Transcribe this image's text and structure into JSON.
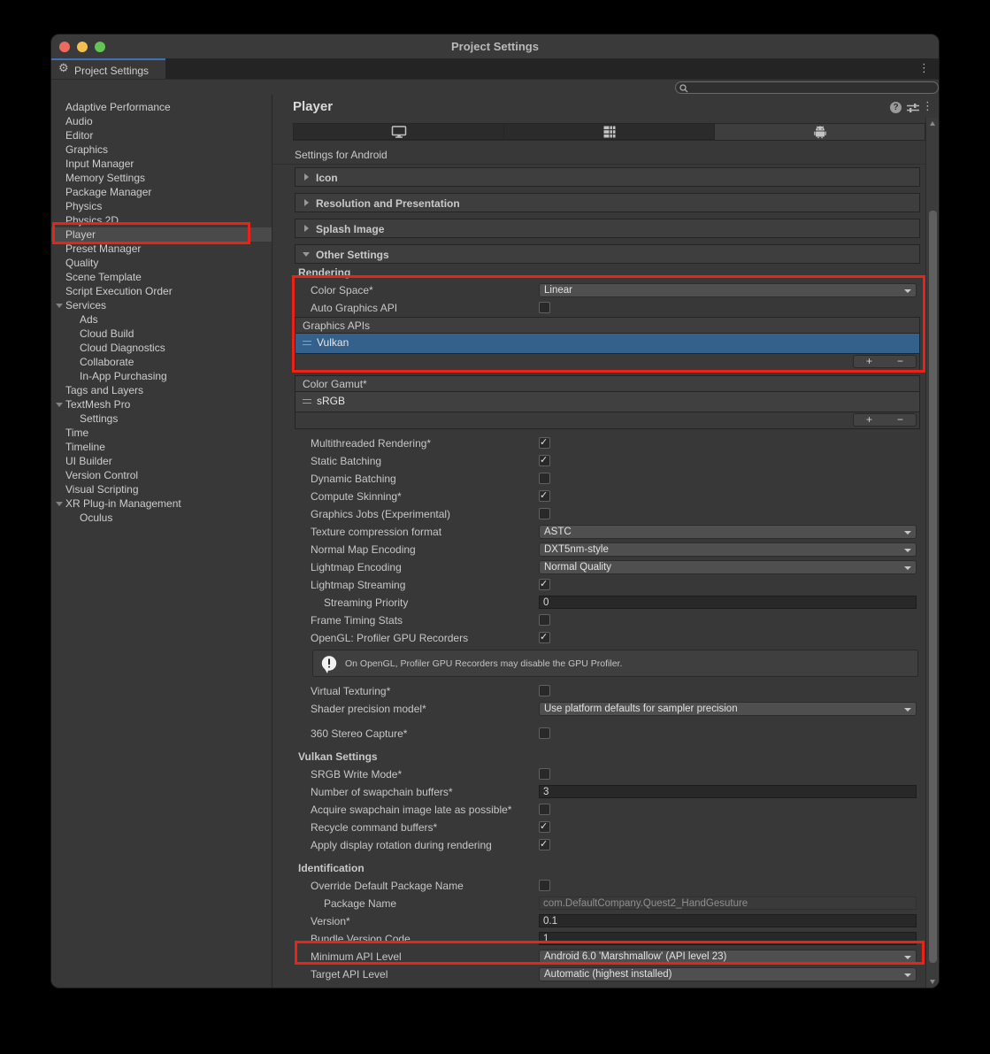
{
  "window": {
    "title": "Project Settings",
    "tab_label": "Project Settings"
  },
  "search": {
    "value": "",
    "placeholder": ""
  },
  "sidebar": {
    "items": [
      {
        "label": "Adaptive Performance",
        "level": 1
      },
      {
        "label": "Audio",
        "level": 1
      },
      {
        "label": "Editor",
        "level": 1
      },
      {
        "label": "Graphics",
        "level": 1
      },
      {
        "label": "Input Manager",
        "level": 1
      },
      {
        "label": "Memory Settings",
        "level": 1
      },
      {
        "label": "Package Manager",
        "level": 1
      },
      {
        "label": "Physics",
        "level": 1
      },
      {
        "label": "Physics 2D",
        "level": 1
      },
      {
        "label": "Player",
        "level": 1,
        "selected": true
      },
      {
        "label": "Preset Manager",
        "level": 1
      },
      {
        "label": "Quality",
        "level": 1
      },
      {
        "label": "Scene Template",
        "level": 1
      },
      {
        "label": "Script Execution Order",
        "level": 1
      },
      {
        "label": "Services",
        "level": 1,
        "expander": true
      },
      {
        "label": "Ads",
        "level": 2
      },
      {
        "label": "Cloud Build",
        "level": 2
      },
      {
        "label": "Cloud Diagnostics",
        "level": 2
      },
      {
        "label": "Collaborate",
        "level": 2
      },
      {
        "label": "In-App Purchasing",
        "level": 2
      },
      {
        "label": "Tags and Layers",
        "level": 1
      },
      {
        "label": "TextMesh Pro",
        "level": 1,
        "expander": true
      },
      {
        "label": "Settings",
        "level": 2
      },
      {
        "label": "Time",
        "level": 1
      },
      {
        "label": "Timeline",
        "level": 1
      },
      {
        "label": "UI Builder",
        "level": 1
      },
      {
        "label": "Version Control",
        "level": 1
      },
      {
        "label": "Visual Scripting",
        "level": 1
      },
      {
        "label": "XR Plug-in Management",
        "level": 1,
        "expander": true
      },
      {
        "label": "Oculus",
        "level": 2
      }
    ]
  },
  "player": {
    "title": "Player",
    "context": "Settings for Android"
  },
  "platform_tabs": [
    {
      "icon": "desktop-icon",
      "selected": false
    },
    {
      "icon": "dedicated-server-icon",
      "selected": false
    },
    {
      "icon": "android-icon",
      "selected": true
    }
  ],
  "foldouts": [
    {
      "label": "Icon",
      "expanded": false
    },
    {
      "label": "Resolution and Presentation",
      "expanded": false
    },
    {
      "label": "Splash Image",
      "expanded": false
    },
    {
      "label": "Other Settings",
      "expanded": true
    }
  ],
  "rows": [
    {
      "t": "section",
      "label": "Rendering"
    },
    {
      "t": "dropdown",
      "label": "Color Space*",
      "value": "Linear"
    },
    {
      "t": "check",
      "label": "Auto Graphics API",
      "checked": false
    },
    {
      "t": "list",
      "header": "Graphics APIs",
      "items": [
        {
          "label": "Vulkan",
          "selected": true
        }
      ],
      "add_label": "+",
      "remove_label": "−"
    },
    {
      "t": "gap",
      "h": 5
    },
    {
      "t": "list",
      "header": "Color Gamut*",
      "items": [
        {
          "label": "sRGB",
          "selected": false
        }
      ],
      "add_label": "+",
      "remove_label": "−"
    },
    {
      "t": "gap",
      "h": 6
    },
    {
      "t": "check",
      "label": "Multithreaded Rendering*",
      "checked": true
    },
    {
      "t": "check",
      "label": "Static Batching",
      "checked": true
    },
    {
      "t": "check",
      "label": "Dynamic Batching",
      "checked": false
    },
    {
      "t": "check",
      "label": "Compute Skinning*",
      "checked": true
    },
    {
      "t": "check",
      "label": "Graphics Jobs (Experimental)",
      "checked": false
    },
    {
      "t": "dropdown",
      "label": "Texture compression format",
      "value": "ASTC"
    },
    {
      "t": "dropdown",
      "label": "Normal Map Encoding",
      "value": "DXT5nm-style"
    },
    {
      "t": "dropdown",
      "label": "Lightmap Encoding",
      "value": "Normal Quality"
    },
    {
      "t": "check",
      "label": "Lightmap Streaming",
      "checked": true
    },
    {
      "t": "field",
      "label": "Streaming Priority",
      "value": "0",
      "indent": 2
    },
    {
      "t": "check",
      "label": "Frame Timing Stats",
      "checked": false
    },
    {
      "t": "check",
      "label": "OpenGL: Profiler GPU Recorders",
      "checked": true
    },
    {
      "t": "helpbox",
      "text": "On OpenGL, Profiler GPU Recorders may disable the GPU Profiler."
    },
    {
      "t": "check",
      "label": "Virtual Texturing*",
      "checked": false
    },
    {
      "t": "dropdown",
      "label": "Shader precision model*",
      "value": "Use platform defaults for sampler precision"
    },
    {
      "t": "gap",
      "h": 8
    },
    {
      "t": "check",
      "label": "360 Stereo Capture*",
      "checked": false
    },
    {
      "t": "gap",
      "h": 6
    },
    {
      "t": "section",
      "label": "Vulkan Settings"
    },
    {
      "t": "check",
      "label": "SRGB Write Mode*",
      "checked": false
    },
    {
      "t": "field",
      "label": "Number of swapchain buffers*",
      "value": "3"
    },
    {
      "t": "check",
      "label": "Acquire swapchain image late as possible*",
      "checked": false
    },
    {
      "t": "check",
      "label": "Recycle command buffers*",
      "checked": true
    },
    {
      "t": "check",
      "label": "Apply display rotation during rendering",
      "checked": true
    },
    {
      "t": "gap",
      "h": 6
    },
    {
      "t": "section",
      "label": "Identification"
    },
    {
      "t": "check",
      "label": "Override Default Package Name",
      "checked": false
    },
    {
      "t": "field",
      "label": "Package Name",
      "value": "com.DefaultCompany.Quest2_HandGesuture",
      "indent": 2,
      "disabled": true
    },
    {
      "t": "field",
      "label": "Version*",
      "value": "0.1"
    },
    {
      "t": "field",
      "label": "Bundle Version Code",
      "value": "1"
    },
    {
      "t": "dropdown",
      "label": "Minimum API Level",
      "value": "Android 6.0 'Marshmallow' (API level 23)"
    },
    {
      "t": "dropdown",
      "label": "Target API Level",
      "value": "Automatic (highest installed)"
    }
  ],
  "colors": {
    "annotation_red": "#ea2316",
    "list_selection_blue": "#33618c",
    "active_tab_accent_blue": "#3e72b8",
    "traffic_close": "#ed6a5e",
    "traffic_min": "#f5bf4f",
    "traffic_zoom": "#62c554"
  }
}
